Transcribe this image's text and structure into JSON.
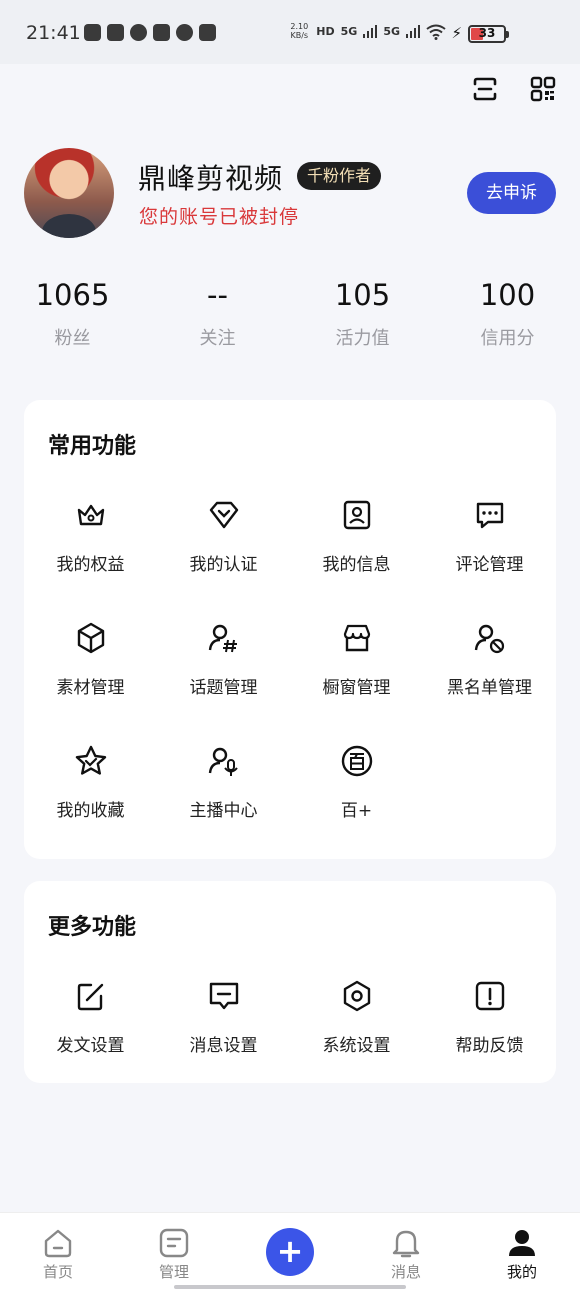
{
  "status_bar": {
    "time": "21:41",
    "net_speed_value": "2.10",
    "net_speed_unit": "KB/s",
    "signal_1": "5G",
    "signal_2": "5G",
    "battery": "33"
  },
  "header": {
    "icons": [
      "scan-icon",
      "qr-code-icon"
    ]
  },
  "profile": {
    "name": "鼎峰剪视频",
    "badge": "千粉作者",
    "ban_notice": "您的账号已被封停",
    "appeal_button": "去申诉"
  },
  "stats": [
    {
      "value": "1065",
      "label": "粉丝"
    },
    {
      "value": "--",
      "label": "关注"
    },
    {
      "value": "105",
      "label": "活力值"
    },
    {
      "value": "100",
      "label": "信用分"
    }
  ],
  "common_functions": {
    "title": "常用功能",
    "items": [
      {
        "label": "我的权益",
        "icon": "crown-icon"
      },
      {
        "label": "我的认证",
        "icon": "verify-icon"
      },
      {
        "label": "我的信息",
        "icon": "profile-card-icon"
      },
      {
        "label": "评论管理",
        "icon": "comment-icon"
      },
      {
        "label": "素材管理",
        "icon": "cube-icon"
      },
      {
        "label": "话题管理",
        "icon": "user-hashtag-icon"
      },
      {
        "label": "橱窗管理",
        "icon": "store-icon"
      },
      {
        "label": "黑名单管理",
        "icon": "user-block-icon"
      },
      {
        "label": "我的收藏",
        "icon": "star-icon"
      },
      {
        "label": "主播中心",
        "icon": "user-mic-icon"
      },
      {
        "label": "百+",
        "icon": "bai-icon"
      }
    ]
  },
  "more_functions": {
    "title": "更多功能",
    "items": [
      {
        "label": "发文设置",
        "icon": "edit-icon"
      },
      {
        "label": "消息设置",
        "icon": "message-icon"
      },
      {
        "label": "系统设置",
        "icon": "settings-hex-icon"
      },
      {
        "label": "帮助反馈",
        "icon": "help-icon"
      }
    ]
  },
  "bottom_nav": [
    {
      "label": "首页",
      "icon": "home-icon"
    },
    {
      "label": "管理",
      "icon": "manage-icon"
    },
    {
      "label": "",
      "icon": "plus-icon"
    },
    {
      "label": "消息",
      "icon": "bell-icon"
    },
    {
      "label": "我的",
      "icon": "person-icon"
    }
  ],
  "colors": {
    "accent": "#3b4fd8",
    "warning": "#d9383a",
    "background": "#f5f6fa"
  }
}
